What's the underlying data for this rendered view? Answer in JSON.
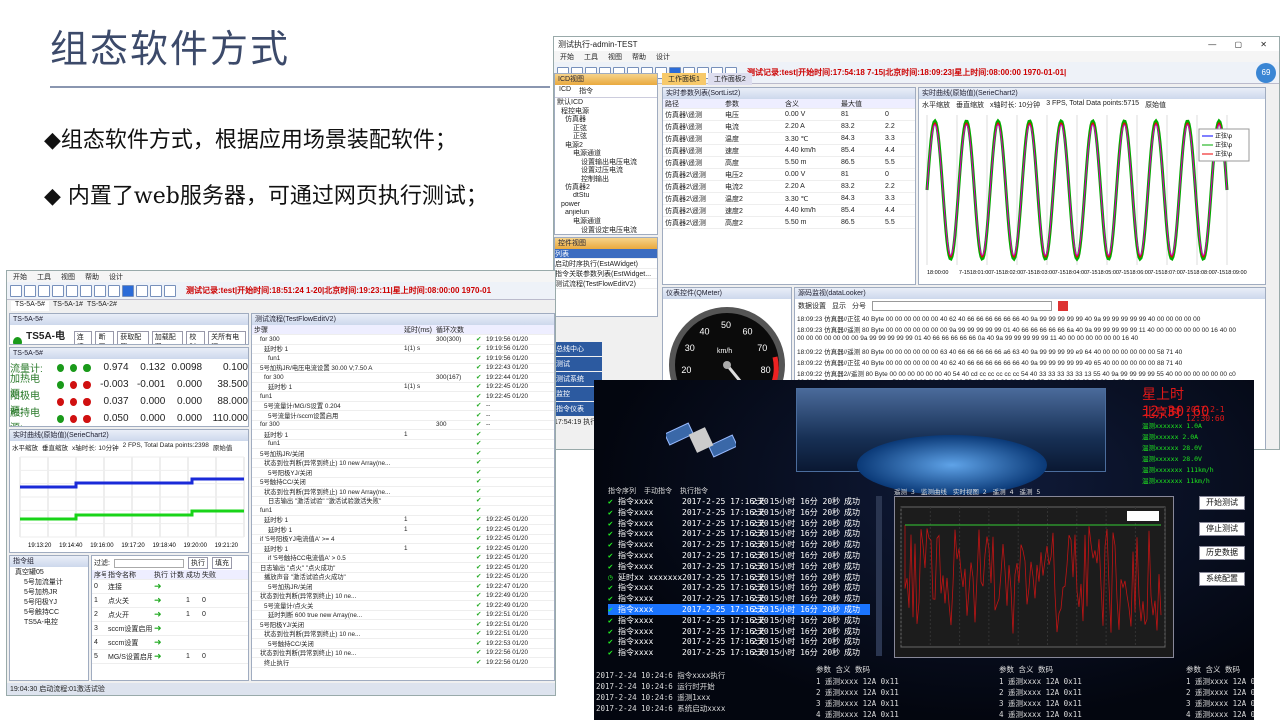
{
  "slide": {
    "title": "组态软件方式",
    "bullets": [
      "◆组态软件方式，根据应用场景装配软件；",
      "◆ 内置了web服务器，可通过网页执行测试；"
    ]
  },
  "win_right": {
    "title": "测试执行-admin-TEST",
    "menu": [
      "开始",
      "工具",
      "视图",
      "帮助",
      "设计"
    ],
    "status": "测试记录:test|开始时间:17:54:18 7-15|北京时间:18:09:23|星上时间:08:00:00 1970-01-01|",
    "badge": "69",
    "icd_title": "ICD视图",
    "icd_tabs": [
      "ICD",
      "指令"
    ],
    "tree": [
      "默认ICD",
      "程控电源",
      "仿真器",
      "正弦",
      "正弦",
      "电源2",
      "电源通道",
      "设置输出电压电流",
      "设置过压电流",
      "控制输出",
      "仿真器2",
      "dtStu",
      "power",
      "anjielun",
      "电源通道",
      "设置设定电压电流"
    ],
    "ctrl_title": "控件视图",
    "ctrl_items": [
      "列表",
      "启动时序执行(EstAWidget)",
      "指令关联参数列表(EstWidget...",
      "测试流程(TestFlowEditV2)"
    ],
    "tabs": [
      "工作面板1",
      "工作面板2"
    ],
    "sort_title": "实时参数列表(SortList2)",
    "sort_head": [
      "路径",
      "参数",
      "含义",
      "最大值",
      ""
    ],
    "sort_rows": [
      [
        "仿真器\\遥测",
        "电压",
        "0.00 V",
        "81",
        "0"
      ],
      [
        "仿真器\\遥测",
        "电流",
        "2.20 A",
        "83.2",
        "2.2"
      ],
      [
        "仿真器\\遥测",
        "温度",
        "3.30 ℃",
        "84.3",
        "3.3"
      ],
      [
        "仿真器\\遥测",
        "速度",
        "4.40 km/h",
        "85.4",
        "4.4"
      ],
      [
        "仿真器\\遥测",
        "高度",
        "5.50 m",
        "86.5",
        "5.5"
      ],
      [
        "仿真器2\\遥测",
        "电压2",
        "0.00 V",
        "81",
        "0"
      ],
      [
        "仿真器2\\遥测",
        "电流2",
        "2.20 A",
        "83.2",
        "2.2"
      ],
      [
        "仿真器2\\遥测",
        "温度2",
        "3.30 ℃",
        "84.3",
        "3.3"
      ],
      [
        "仿真器2\\遥测",
        "速度2",
        "4.40 km/h",
        "85.4",
        "4.4"
      ],
      [
        "仿真器2\\遥测",
        "高度2",
        "5.50 m",
        "86.5",
        "5.5"
      ]
    ],
    "curve_title": "实时曲线(原始值)(SerieChart2)",
    "curve_opts": [
      "水平缩放",
      "垂直缩放",
      "x轴时长: 10分钟",
      "3 FPS, Total Data points:5715",
      "原始值"
    ],
    "legend": [
      "正弦\\p",
      "正弦\\p",
      "正弦\\p"
    ],
    "xticks": [
      "18:00:00",
      "7-1518:01:00",
      "7-1518:02:00",
      "7-1518:03:00",
      "7-1518:04:00",
      "7-1518:05:00",
      "7-1518:06:00",
      "7-1518:07:00",
      "7-1518:08:00",
      "7-1518:09:00"
    ],
    "meter_title": "仪表控件(QMeter)",
    "gauge_ticks": [
      "10",
      "20",
      "30",
      "40",
      "50",
      "60",
      "70",
      "80",
      "90"
    ],
    "gauge_unit": "km/h",
    "gauge_val": "83.3",
    "log_title": "源码监视(dataLooker)",
    "log_opts": [
      "数据设置",
      "显示",
      "分号"
    ],
    "log_lines": [
      "18:09:23 仿真器//正弦 40 Byte 00 00 00 00 00 00 40 62 40 66 66 66 66 66 66 40 9a 99 99 99 99 99 40 9a 99 99 99 99 99 40 00 00 00 00 00",
      "18:09:23 仿真器//遥测 80 Byte 00 00 00 00 00 00 00 9a 99 99 99 99 99 01 40 66 66 66 66 66 6a 40 9a 99 99 99 99 99 11 40 00 00 00 00 00 00 16 40 00",
      "00 00 00 00 00 00 00 9a 99 99 99 99 99 01 40 66 66 66 66 66 0a 40 9a 99 99 99 99 99 11 40 00 00 00 00 00 00 16 40",
      "18:09:22 仿真器//遥测 80 Byte 00 00 00 00 00 00 63 40 66 66 66 66 66 a6 63 40 9a 99 99 99 99 e9 64 40 00 00 00 00 00 00 58 71 40",
      "18:09:22 仿真器//正弦 40 Byte 00 00 00 00 00 00 40 62 40 66 66 66 66 66 66 40 9a 99 99 99 99 99 49 65 40 00 00 00 00 00 88 71 40",
      "18:09:22 仿真器2//遥测 80 Byte 00 00 00 00 00 00 40 54 40 cd cc cc cc cc cc 54 40 33 33 33 33 33 13 55 40 9a 99 99 99 99 55 40 00 00 00 00 00 00 c0",
      "00 00 40 54 40 cd cc cc cc cc cc 54 40 33 33 33 33 33 13 55 40 9a 99 99 99 99 99 55 40 00 00 00 00 00 00 c0 55 40"
    ],
    "side_btns": [
      "总线中心",
      "测试",
      "测试系统",
      "监控",
      "指令仪表"
    ],
    "side_time": "17:54:19 执行"
  },
  "win_left": {
    "menu": [
      "开始",
      "工具",
      "视图",
      "帮助",
      "设计"
    ],
    "status": "测试记录:test|开始时间:18:51:24 1-20|北京时间:19:23:11|星上时间:08:00:00 1970-01",
    "tabs": [
      "TS-5A-5#",
      "TS-5A-1#",
      "TS-5A-2#"
    ],
    "dev_panel": "TS-5A-5#",
    "dev_title": "TS5A-电控",
    "dev_btns": [
      "连接",
      "断开",
      "获取配置",
      "加载配置",
      "校时",
      "关所有电源"
    ],
    "meas_panel": "TS-5A-5#",
    "meas": [
      {
        "label": "流量计:",
        "dots": [
          "g",
          "g",
          "g"
        ],
        "vals": [
          "0.974",
          "0.132",
          "0.0098",
          "0.100"
        ]
      },
      {
        "label": "加热电源:",
        "dots": [
          "g",
          "r",
          "r"
        ],
        "vals": [
          "-0.003",
          "-0.001",
          "0.000",
          "38.500"
        ]
      },
      {
        "label": "阳极电源:",
        "dots": [
          "r",
          "r",
          "r"
        ],
        "vals": [
          "0.037",
          "0.000",
          "0.000",
          "88.000"
        ]
      },
      {
        "label": "触持电源:",
        "dots": [
          "g",
          "r",
          "r"
        ],
        "vals": [
          "0.050",
          "0.000",
          "0.000",
          "110.000"
        ]
      }
    ],
    "curve_title": "实时曲线(原始值)(SerieChart2)",
    "curve_opts": [
      "水平缩放",
      "垂直缩放",
      "x轴时长: 10分钟",
      "2 FPS, Total Data points:2398",
      "原始值"
    ],
    "xticks": [
      "19:13:20",
      "19:14:40",
      "19:16:00",
      "19:17:20",
      "19:18:40",
      "19:20:00",
      "19:21:20"
    ],
    "group_title": "指令组",
    "filter": "过滤:",
    "exec": "执行",
    "fill": "填充",
    "tree": [
      "真空罐05",
      "5号加流量计",
      "5号加热JR",
      "5号阳极YJ",
      "5号触持CC",
      "TS5A-电控"
    ],
    "cmd_head": [
      "序号",
      "指令名称",
      "执行",
      "计数",
      "成功",
      "失败"
    ],
    "cmds": [
      [
        "0",
        "连接",
        "",
        "",
        ""
      ],
      [
        "1",
        "点火关",
        "",
        "1",
        "0"
      ],
      [
        "2",
        "点火开",
        "",
        "1",
        "0"
      ],
      [
        "3",
        "sccm设置启用",
        "",
        "",
        ""
      ],
      [
        "4",
        "sccm设置",
        "",
        "",
        ""
      ],
      [
        "5",
        "MG/S设置启用",
        "",
        "1",
        "0"
      ]
    ],
    "flow_title": "测试流程(TestFlowEditV2)",
    "flow_head": [
      "步骤",
      "延时(ms)",
      "循环次数"
    ],
    "flow": [
      [
        "for 300",
        "",
        "300(300)",
        "19:19:56 01/20"
      ],
      [
        "延时秒 1",
        "1(1) s",
        "",
        "19:19:56 01/20"
      ],
      [
        "fun1",
        "",
        "",
        "19:19:56 01/20"
      ],
      [
        "5号加热JR/电压电流设置 30.00 V;7.50 A",
        "",
        "",
        "19:22:43 01/20"
      ],
      [
        "for 300",
        "",
        "300(167)",
        "19:22:44 01/20"
      ],
      [
        "延时秒 1",
        "1(1) s",
        "",
        "19:22:45 01/20"
      ],
      [
        "fun1",
        "",
        "",
        "19:22:45 01/20"
      ],
      [
        "5号流量计/MG/S设置 0.204",
        "",
        "",
        "--"
      ],
      [
        "5号流量计/sccm设置启用",
        "",
        "",
        "--"
      ],
      [
        "for 300",
        "",
        "300",
        "--"
      ],
      [
        "延时秒 1",
        "1",
        "",
        ""
      ],
      [
        "fun1",
        "",
        "",
        ""
      ],
      [
        "5号加热JR/关闭",
        "",
        "",
        ""
      ],
      [
        "状态到位判断(异常到终止) 10 new Array(ne...",
        "",
        "",
        ""
      ],
      [
        "5号阳极YJ/关闭",
        "",
        "",
        ""
      ],
      [
        "5号触持CC/关闭",
        "",
        "",
        ""
      ],
      [
        "状态到位判断(异常到终止) 10 new Array(ne...",
        "",
        "",
        ""
      ],
      [
        "日志输出 \"激活试验\" \"激活试验激活失败\"",
        "",
        "",
        ""
      ],
      [
        "fun1",
        "",
        "",
        ""
      ],
      [
        "延时秒 1",
        "1",
        "",
        "19:22:45 01/20"
      ],
      [
        "延时秒 1",
        "1",
        "",
        "19:22:45 01/20"
      ],
      [
        "if '5号阳极YJ电流值A' >= 4",
        "",
        "",
        "19:22:45 01/20"
      ],
      [
        "延时秒 1",
        "1",
        "",
        "19:22:45 01/20"
      ],
      [
        "if '5号触持CC电流值A' > 0.5",
        "",
        "",
        "19:22:45 01/20"
      ],
      [
        "日志输出 \"点火\" \"点火成功\"",
        "",
        "",
        "19:22:45 01/20"
      ],
      [
        "播放声音 \"激活试验点火成功\"",
        "",
        "",
        "19:22:45 01/20"
      ],
      [
        "5号加热JR/关闭",
        "",
        "",
        "19:22:47 01/20"
      ],
      [
        "状态到位判断(异常到终止) 10 ne...",
        "",
        "",
        "19:22:49 01/20"
      ],
      [
        "5号流量计/点火关",
        "",
        "",
        "19:22:49 01/20"
      ],
      [
        "延时判断 600 true new Array(ne...",
        "",
        "",
        "19:22:51 01/20"
      ],
      [
        "5号阳极YJ/关闭",
        "",
        "",
        "19:22:51 01/20"
      ],
      [
        "状态到位判断(异常到终止) 10 ne...",
        "",
        "",
        "19:22:51 01/20"
      ],
      [
        "5号触持CC/关闭",
        "",
        "",
        "19:22:53 01/20"
      ],
      [
        "状态到位判断(异常到终止) 10 ne...",
        "",
        "",
        "19:22:56 01/20"
      ],
      [
        "终止执行",
        "",
        "",
        "19:22:56 01/20"
      ]
    ],
    "footer": "19:04:30 启动流程:01激活试验"
  },
  "dark": {
    "star_time": "星上时 12:30:60",
    "bj_time": "北京时",
    "bj_date": "2017-2-1 12:30:60",
    "tm": [
      "温测xxxxxxx 1.0A",
      "温测xxxxxx 2.0A",
      "温测xxxxxx 28.0V",
      "温测xxxxxx 28.0V",
      "温测xxxxxxx 111km/h",
      "温测xxxxxxx 11km/h"
    ],
    "cmd_tabs": [
      "指令序列",
      "手动指令",
      "执行指令"
    ],
    "chart_tabs": [
      "遥测 3",
      "监测曲线",
      "实时视图 2",
      "遥测 4",
      "遥测 5"
    ],
    "rows": [
      [
        "指令xxxx",
        "2017-2-25 17:16:20",
        "2天 15小时 16分 20秒",
        "成功"
      ],
      [
        "指令xxxx",
        "2017-2-25 17:16:20",
        "2天 15小时 16分 20秒",
        "成功"
      ],
      [
        "指令xxxx",
        "2017-2-25 17:16:20",
        "2天 15小时 16分 20秒",
        "成功"
      ],
      [
        "指令xxxx",
        "2017-2-25 17:16:20",
        "2天 15小时 16分 20秒",
        "成功"
      ],
      [
        "指令xxxx",
        "2017-2-25 17:16:20",
        "2天 15小时 16分 20秒",
        "成功"
      ],
      [
        "指令xxxx",
        "2017-2-25 17:16:20",
        "2天 15小时 16分 20秒",
        "成功"
      ],
      [
        "指令xxxx",
        "2017-2-25 17:16:20",
        "2天 15小时 16分 20秒",
        "成功"
      ],
      [
        "延时xx xxxxxxx",
        "2017-2-25 17:16:20",
        "2天 15小时 16分 20秒",
        "成功"
      ],
      [
        "指令xxxx",
        "2017-2-25 17:16:20",
        "2天 15小时 16分 20秒",
        "成功"
      ],
      [
        "指令xxxx",
        "2017-2-25 17:16:20",
        "2天 15小时 16分 20秒",
        "成功"
      ],
      [
        "指令xxxx",
        "2017-2-25 17:16:20",
        "2天 15小时 16分 20秒",
        "成功"
      ],
      [
        "指令xxxx",
        "2017-2-25 17:16:20",
        "2天 15小时 16分 20秒",
        "成功"
      ],
      [
        "指令xxxx",
        "2017-2-25 17:16:20",
        "2天 15小时 16分 20秒",
        "成功"
      ],
      [
        "指令xxxx",
        "2017-2-25 17:16:20",
        "2天 15小时 16分 20秒",
        "成功"
      ],
      [
        "指令xxxx",
        "2017-2-25 17:16:20",
        "2天 15小时 16分 20秒",
        "成功"
      ]
    ],
    "side_btns": [
      "开始测试",
      "停止测试",
      "历史数据",
      "系统配置"
    ],
    "logs": [
      "2017-2-24 10:24:6 指令xxxx执行",
      "2017-2-24 10:24:6 运行时开始",
      "2017-2-24 10:24:6 遥测1xxx",
      "2017-2-24 10:24:6 系统启动xxxx"
    ],
    "param_head": "参数 含义 数码",
    "params": [
      "1 遥测xxxx 12A 0x11",
      "2 遥测xxxx 12A 0x11",
      "3 遥测xxxx 12A 0x11",
      "4 遥测xxxx 12A 0x11"
    ]
  }
}
